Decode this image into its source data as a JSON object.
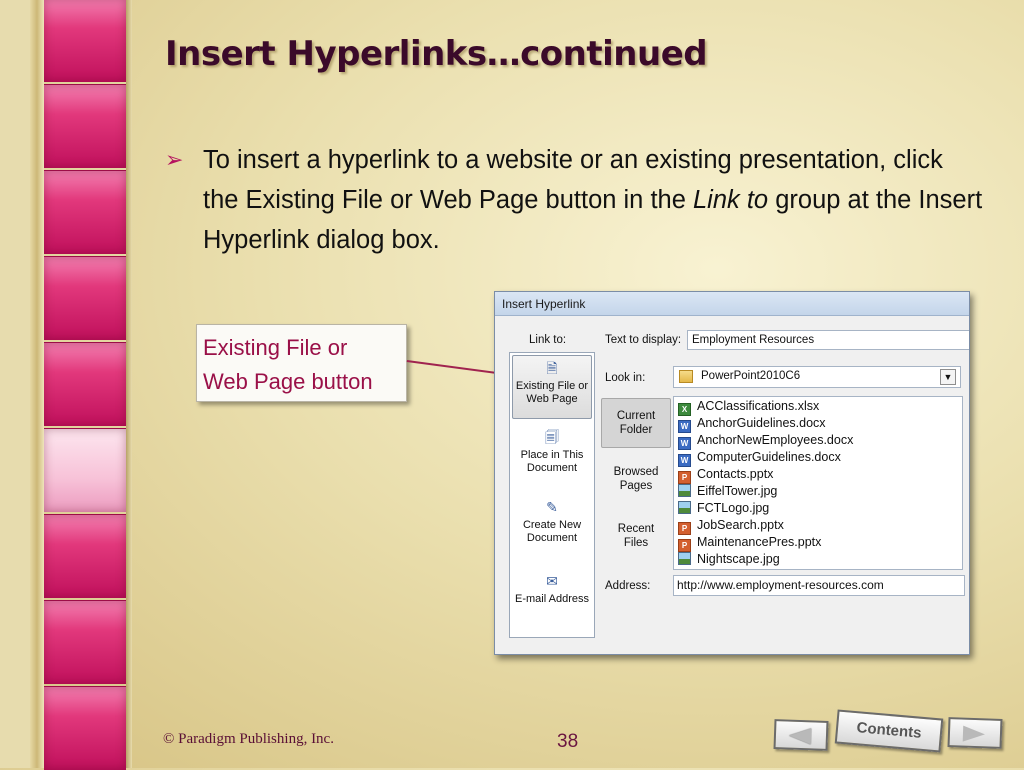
{
  "slide": {
    "title": "Insert Hyperlinks…continued",
    "bullet": {
      "part1": "To insert a hyperlink to a website or an existing presentation, click the Existing File or Web Page button in the ",
      "italic": "Link to",
      "part2": " group at the Insert Hyperlink dialog box."
    },
    "callout": {
      "line1": "Existing File or",
      "line2": "Web Page button"
    }
  },
  "dialog": {
    "title": "Insert Hyperlink",
    "link_to_label": "Link to:",
    "text_display_label": "Text to display:",
    "text_display_value": "Employment Resources",
    "look_in_label": "Look in:",
    "look_in_value": "PowerPoint2010C6",
    "link_to_buttons": [
      {
        "line1": "Existing File or",
        "line2": "Web Page",
        "icon": "existing-file-icon"
      },
      {
        "line1": "Place in This",
        "line2": "Document",
        "icon": "place-in-document-icon"
      },
      {
        "line1": "Create New",
        "line2": "Document",
        "icon": "create-new-document-icon"
      },
      {
        "line1": "E-mail Address",
        "line2": "",
        "icon": "email-icon"
      }
    ],
    "nav_buttons": [
      {
        "line1": "Current",
        "line2": "Folder"
      },
      {
        "line1": "Browsed",
        "line2": "Pages"
      },
      {
        "line1": "Recent",
        "line2": "Files"
      }
    ],
    "files": [
      {
        "name": "ACClassifications.xlsx",
        "type": "xlsx"
      },
      {
        "name": "AnchorGuidelines.docx",
        "type": "docx"
      },
      {
        "name": "AnchorNewEmployees.docx",
        "type": "docx"
      },
      {
        "name": "ComputerGuidelines.docx",
        "type": "docx"
      },
      {
        "name": "Contacts.pptx",
        "type": "pptx"
      },
      {
        "name": "EiffelTower.jpg",
        "type": "jpg"
      },
      {
        "name": "FCTLogo.jpg",
        "type": "jpg"
      },
      {
        "name": "JobSearch.pptx",
        "type": "pptx"
      },
      {
        "name": "MaintenancePres.pptx",
        "type": "pptx"
      },
      {
        "name": "Nightscape.jpg",
        "type": "jpg"
      }
    ],
    "address_label": "Address:",
    "address_value": "http://www.employment-resources.com"
  },
  "footer": {
    "copyright": "© Paradigm Publishing, Inc.",
    "page_number": "38",
    "contents_label": "Contents"
  }
}
